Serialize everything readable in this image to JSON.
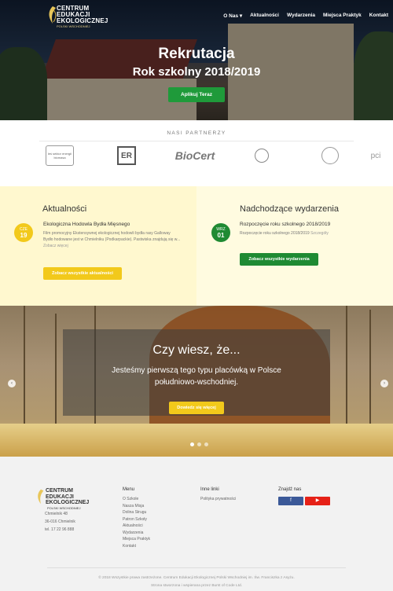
{
  "nav": {
    "logo": {
      "line1": "CENTRUM",
      "line2": "EDUKACJI",
      "line3": "EKOLOGICZNEJ",
      "sub": "POLSKI WSCHODNIEJ"
    },
    "items": [
      "O Nas ▾",
      "Aktualności",
      "Wydarzenia",
      "Miejsca Praktyk",
      "Kontakt"
    ]
  },
  "hero": {
    "title": "Rekrutacja",
    "subtitle": "Rok szkolny 2018/2019",
    "button": "Aplikuj Teraz"
  },
  "partners": {
    "title": "NASI PARTNERZY",
    "logos": [
      "leś sektor energii biomasa",
      "ER",
      "BioCert",
      "",
      "",
      "pci"
    ]
  },
  "news": {
    "title": "Aktualności",
    "date_month": "CZE",
    "date_day": "19",
    "item_title": "Ekologiczna Hodowla Bydła Mięsnego",
    "item_text": "Film promocyjny Ekstensywnej ekologicznej hodowli bydła rasy Galloway Bydło hodowane jest w Chmielniku (Podkarpackie). Pastwiska znajdują się w...",
    "more": "Zobacz więcej",
    "button": "Zobacz wszystkie aktualności"
  },
  "events": {
    "title": "Nadchodzące wydarzenia",
    "date_month": "WRZ",
    "date_day": "01",
    "item_title": "Rozpoczęcie roku szkolnego 2018/2019",
    "item_text": "Rozpoczęcie roku szkolnego 2018/2019",
    "more": "Szczegóły",
    "button": "Zobacz wszystkie wydarzenia"
  },
  "dyk": {
    "title": "Czy wiesz, że...",
    "text": "Jesteśmy pierwszą tego typu placówką w Polsce południowo-wschodniej.",
    "button": "Dowiedz się więcej",
    "prev": "‹",
    "next": "›"
  },
  "footer": {
    "logo": {
      "line1": "CENTRUM",
      "line2": "EDUKACJI",
      "line3": "EKOLOGICZNEJ",
      "sub": "POLSKI WSCHODNIEJ"
    },
    "address": [
      "Chmielnik 48",
      "36-016 Chmielnik",
      "tel. 17 22 96 888"
    ],
    "menu_title": "Menu",
    "menu": [
      "O Szkole",
      "Nasza Misja",
      "Dolina Strugu",
      "Patron Szkoły",
      "Aktualności",
      "Wydarzenia",
      "Miejsca Praktyk",
      "Kontakt"
    ],
    "other_title": "Inne linki",
    "other": [
      "Polityka prywatności"
    ],
    "find_title": "Znajdź nas",
    "social": [
      {
        "name": "f",
        "color": "#3b5998"
      },
      {
        "name": "▶",
        "color": "#e62117"
      }
    ],
    "copyright1": "© 2018 Wszystkie prawa zastrzeżone. Centrum Edukacji Ekologicznej Polski Wschodniej im. Św. Franciszka z Asyżu.",
    "copyright2": "Strona stworzona i wspierana przez Burst of Code Ltd."
  },
  "colors": {
    "green": "#1f9a3a",
    "yellow": "#f2c91b",
    "news_bg": "#fff8cf",
    "events_bg": "#fffbe0",
    "footer_bg": "#f2f2f2"
  }
}
